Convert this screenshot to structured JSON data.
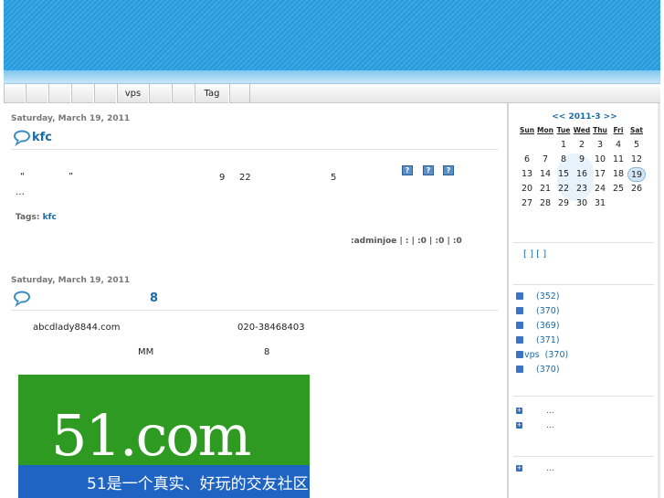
{
  "nav": {
    "items": [
      "",
      "",
      "",
      "",
      "",
      "vps",
      "",
      "",
      "Tag",
      ""
    ]
  },
  "posts": [
    {
      "date": "Saturday, March 19, 2011",
      "title": "kfc",
      "body_line1": [
        "“",
        "”",
        "9",
        "22",
        "5"
      ],
      "ellipsis": "…",
      "icons": [
        "?",
        "?",
        "?"
      ],
      "tags_label": "Tags:",
      "tag": "kfc",
      "meta": ":adminjoe |    :      |    :0 |    :0 |    :0"
    },
    {
      "date": "Saturday, March 19, 2011",
      "title": "8",
      "line1_left": "abcdlady8844.com",
      "line1_right": "020-38468403",
      "line2_left": "MM",
      "line2_right": "8",
      "image": {
        "logo_text": "51.com",
        "slogan": "51是一个真实、好玩的交友社区"
      }
    }
  ],
  "calendar": {
    "header": "<< 2011-3 >>",
    "dow": [
      "Sun",
      "Mon",
      "Tue",
      "Wed",
      "Thu",
      "Fri",
      "Sat"
    ],
    "weeks": [
      [
        "",
        "",
        "1",
        "2",
        "3",
        "4",
        "5"
      ],
      [
        "6",
        "7",
        "8",
        "9",
        "10",
        "11",
        "12"
      ],
      [
        "13",
        "14",
        "15",
        "16",
        "17",
        "18",
        "19"
      ],
      [
        "20",
        "21",
        "22",
        "23",
        "24",
        "25",
        "26"
      ],
      [
        "27",
        "28",
        "29",
        "30",
        "31",
        "",
        ""
      ]
    ],
    "today": "19"
  },
  "sidebar": {
    "bracket_links": "[  ] [  ]",
    "feeds": [
      {
        "label": "",
        "count": "(352)"
      },
      {
        "label": "",
        "count": "(370)"
      },
      {
        "label": "",
        "count": "(369)"
      },
      {
        "label": "",
        "count": "(371)"
      },
      {
        "label": "vps",
        "count": "(370)"
      },
      {
        "label": "",
        "count": "(370)"
      }
    ],
    "recent": [
      "...",
      "..."
    ],
    "recent2": [
      "..."
    ]
  }
}
